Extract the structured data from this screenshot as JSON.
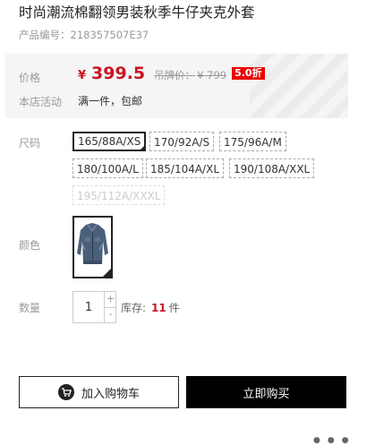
{
  "product": {
    "title": "时尚潮流棉翻领男装秋季牛仔夹克外套",
    "code_label": "产品编号：",
    "code": "218357507E37"
  },
  "pricing": {
    "price_label": "价格",
    "currency": "¥",
    "price": "399.5",
    "original_label": "吊牌价：",
    "original_price": "¥ 799",
    "discount": "5.0折",
    "accent_color": "#c81623"
  },
  "promotion": {
    "label": "本店活动",
    "text": "满一件，包邮"
  },
  "size": {
    "label": "尺码",
    "options": [
      {
        "label": "165/88A/XS",
        "state": "selected"
      },
      {
        "label": "170/92A/S",
        "state": "available"
      },
      {
        "label": "175/96A/M",
        "state": "available"
      },
      {
        "label": "180/100A/L",
        "state": "available"
      },
      {
        "label": "185/104A/XL",
        "state": "available"
      },
      {
        "label": "190/108A/XXL",
        "state": "available"
      },
      {
        "label": "195/112A/XXXL",
        "state": "disabled"
      }
    ]
  },
  "color": {
    "label": "颜色",
    "swatch": "denim-jacket"
  },
  "quantity": {
    "label": "数量",
    "value": "1",
    "plus": "+",
    "minus": "-",
    "stock_label": "库存:",
    "stock_value": "11",
    "stock_unit": "件"
  },
  "actions": {
    "add_to_cart": "加入购物车",
    "cart_icon": "cart-icon",
    "buy_now": "立即购买"
  }
}
